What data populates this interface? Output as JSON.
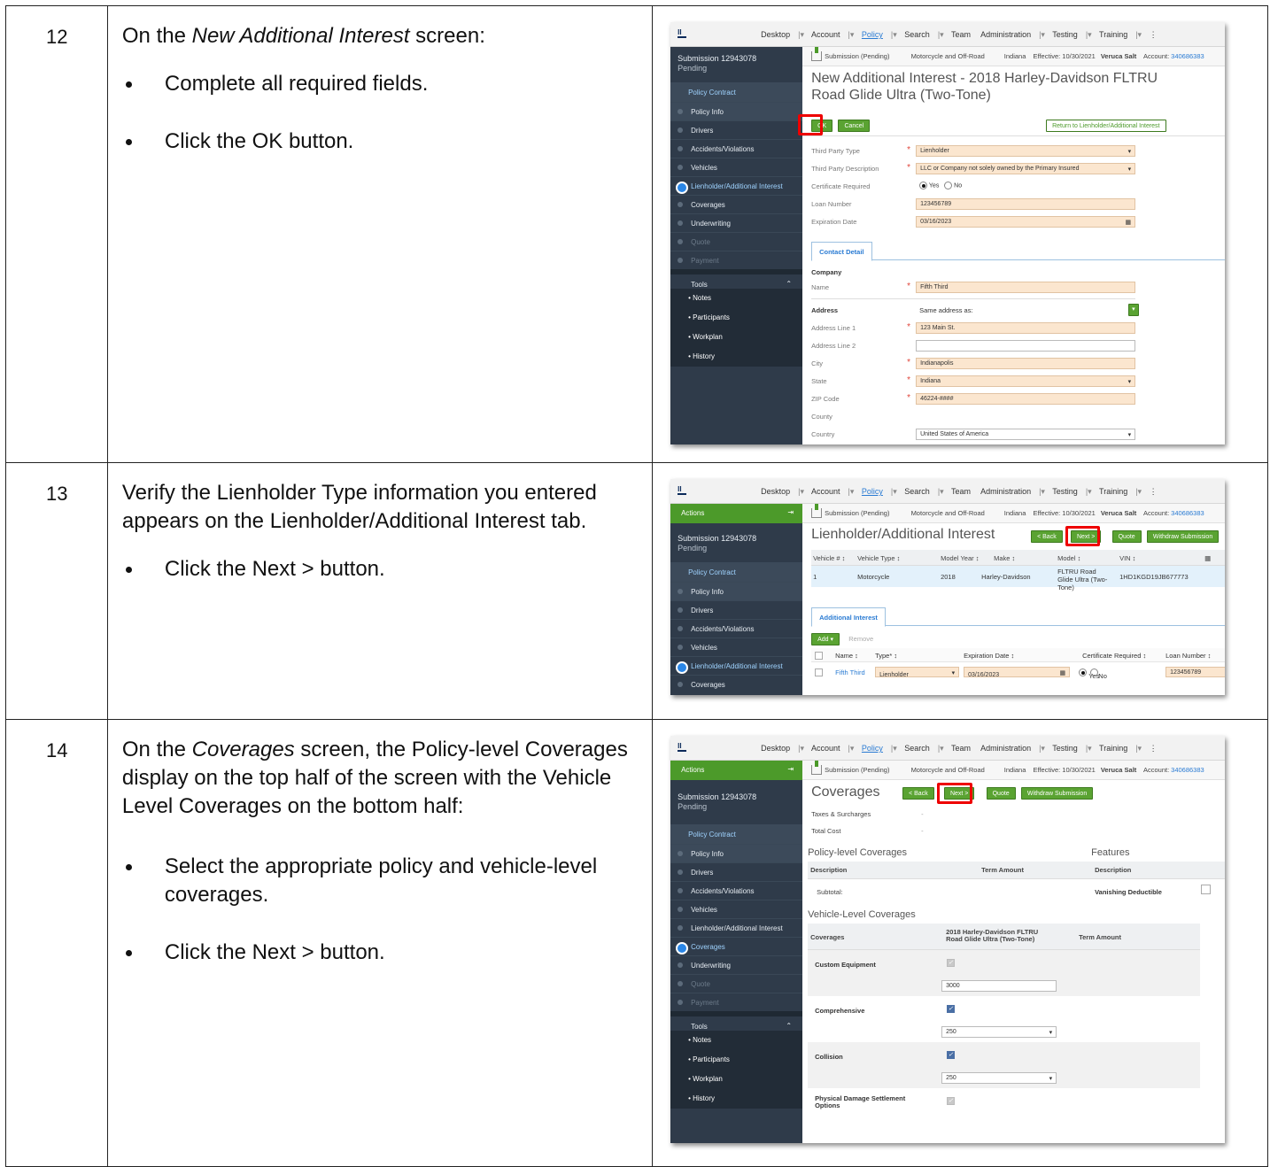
{
  "steps": [
    {
      "number": "12",
      "intro_prefix": "On the ",
      "intro_italic": "New Additional Interest",
      "intro_suffix": " screen:",
      "bullet1": "Complete all required fields.",
      "bullet2_prefix": "Click the ",
      "bullet2_bold": "OK",
      "bullet2_suffix": " button."
    },
    {
      "number": "13",
      "intro_line": "Verify the Lienholder Type information you entered appears on the ",
      "intro_bold": "Lienholder/Additional Interest",
      "intro_suffix": " tab.",
      "bullet1_prefix": "Click the ",
      "bullet1_bold": "Next >",
      "bullet1_suffix": " button."
    },
    {
      "number": "14",
      "intro_prefix": "On the ",
      "intro_italic": "Coverages",
      "intro_mid": " screen, the Policy-level Coverages display on the top half of the screen with the ",
      "intro_bold": "Vehicle Level Coverages",
      "intro_suffix": " on the bottom half:",
      "bullet1": "Select the appropriate policy and vehicle-level coverages.",
      "bullet2_prefix": "Click the ",
      "bullet2_bold": "Next >",
      "bullet2_suffix": " button."
    }
  ],
  "app": {
    "nav": {
      "desktop": "Desktop",
      "account": "Account",
      "policy": "Policy",
      "search": "Search",
      "team": "Team",
      "administration": "Administration",
      "testing": "Testing",
      "training": "Training"
    },
    "infobar": {
      "submission_status": "Submission (Pending)",
      "product": "Motorcycle and Off-Road",
      "state": "Indiana",
      "effective": "Effective: 10/30/2021",
      "insured": "Veruca Salt",
      "account_label": "Account:",
      "account_number": "340686383"
    },
    "sidebar": {
      "actions": "Actions",
      "submission": "Submission 12943078",
      "submission_status": "Pending",
      "group": "Policy Contract",
      "items": {
        "policy_info": "Policy Info",
        "drivers": "Drivers",
        "accidents": "Accidents/Violations",
        "vehicles": "Vehicles",
        "lienholder": "Lienholder/Additional Interest",
        "coverages": "Coverages",
        "underwriting": "Underwriting",
        "quote": "Quote",
        "payment": "Payment"
      },
      "tools": "Tools",
      "tool_items": {
        "notes": "Notes",
        "participants": "Participants",
        "workplan": "Workplan",
        "history": "History"
      }
    },
    "shot1": {
      "title": "New Additional Interest - 2018 Harley-Davidson FLTRU Road Glide Ultra (Two-Tone)",
      "ok": "OK",
      "cancel": "Cancel",
      "return_btn": "Return to Lienholder/Additional Interest",
      "labels": {
        "third_party_type": "Third Party Type",
        "third_party_desc": "Third Party Description",
        "cert_required": "Certificate Required",
        "loan_number": "Loan Number",
        "expiration_date": "Expiration Date",
        "company": "Company",
        "name": "Name",
        "address": "Address",
        "address1": "Address Line 1",
        "address2": "Address Line 2",
        "city": "City",
        "state": "State",
        "zip": "ZIP Code",
        "county": "County",
        "country": "Country"
      },
      "values": {
        "third_party_type": "Lienholder",
        "third_party_desc": "LLC or Company not solely owned by the Primary Insured",
        "yes": "Yes",
        "no": "No",
        "loan_number": "123456789",
        "expiration_date": "03/16/2023",
        "name": "Fifth Third",
        "same_address": "Same address as:",
        "address1": "123 Main St.",
        "address2": "",
        "city": "Indianapolis",
        "state": "Indiana",
        "zip": "46224-####",
        "country": "United States of America"
      },
      "tab": "Contact Detail"
    },
    "shot2": {
      "title": "Lienholder/Additional Interest",
      "back": "< Back",
      "next": "Next >",
      "quote": "Quote",
      "withdraw": "Withdraw Submission",
      "veh_headers": [
        "Vehicle # ↕",
        "Vehicle Type ↕",
        "Model Year ↕",
        "Make ↕",
        "Model ↕",
        "VIN ↕"
      ],
      "veh_row": [
        "1",
        "Motorcycle",
        "2018",
        "Harley-Davidson",
        "FLTRU Road Glide Ultra (Two-Tone)",
        "1HD1KGD19JB677773"
      ],
      "tab": "Additional Interest",
      "add": "Add",
      "remove": "Remove",
      "ai_headers": [
        "Name ↕",
        "Type* ↕",
        "Expiration Date ↕",
        "Certificate Required ↕",
        "Loan Number ↕"
      ],
      "ai_row": {
        "name": "Fifth Third",
        "type": "Lienholder",
        "expiration": "03/16/2023",
        "yes": "Yes",
        "no": "No",
        "loan": "123456789"
      }
    },
    "shot3": {
      "title": "Coverages",
      "back": "< Back",
      "next": "Next >",
      "quote": "Quote",
      "withdraw": "Withdraw Submission",
      "taxes": "Taxes & Surcharges",
      "taxes_val": "-",
      "total": "Total Cost",
      "total_val": "-",
      "policy_level": "Policy-level Coverages",
      "features": "Features",
      "description": "Description",
      "term_amount": "Term Amount",
      "feat_description": "Description",
      "subtotal": "Subtotal:",
      "vanishing": "Vanishing Deductible",
      "vehicle_level": "Vehicle-Level Coverages",
      "coverages_col": "Coverages",
      "vehicle_col": "2018 Harley-Davidson FLTRU Road Glide Ultra (Two-Tone)",
      "term_col": "Term Amount",
      "custom_equipment": "Custom Equipment",
      "custom_value": "3000",
      "comprehensive": "Comprehensive",
      "comp_value": "250",
      "collision": "Collision",
      "coll_value": "250",
      "physical": "Physical Damage Settlement Options"
    }
  }
}
